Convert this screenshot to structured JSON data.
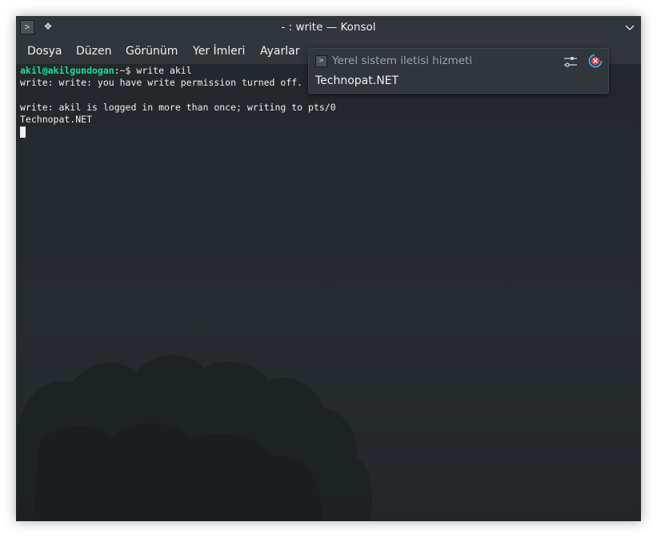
{
  "window": {
    "title": "- : write — Konsol",
    "app_icon": "terminal-icon",
    "pin_icon": "pin-icon",
    "collapse_icon": "chevron-down-icon"
  },
  "menu": {
    "items": [
      {
        "label": "Dosya"
      },
      {
        "label": "Düzen"
      },
      {
        "label": "Görünüm"
      },
      {
        "label": "Yer İmleri"
      },
      {
        "label": "Ayarlar"
      }
    ]
  },
  "terminal": {
    "prompt_user": "akil@akilgundogan",
    "prompt_path": ":~$",
    "command": " write akil",
    "line2": "write: write: you have write permission turned off.",
    "line3": "",
    "line4": "write: akil is logged in more than once; writing to pts/0",
    "line5": "Technopat.NET"
  },
  "notification": {
    "app_name": "Yerel sistem iletisi hizmeti",
    "body": "Technopat.NET",
    "configure_icon": "sliders-icon",
    "close_icon": "close-icon"
  },
  "colors": {
    "prompt_user": "#1cdc9a",
    "background": "#232629",
    "text": "#eff0f1",
    "close": "#da4453"
  }
}
